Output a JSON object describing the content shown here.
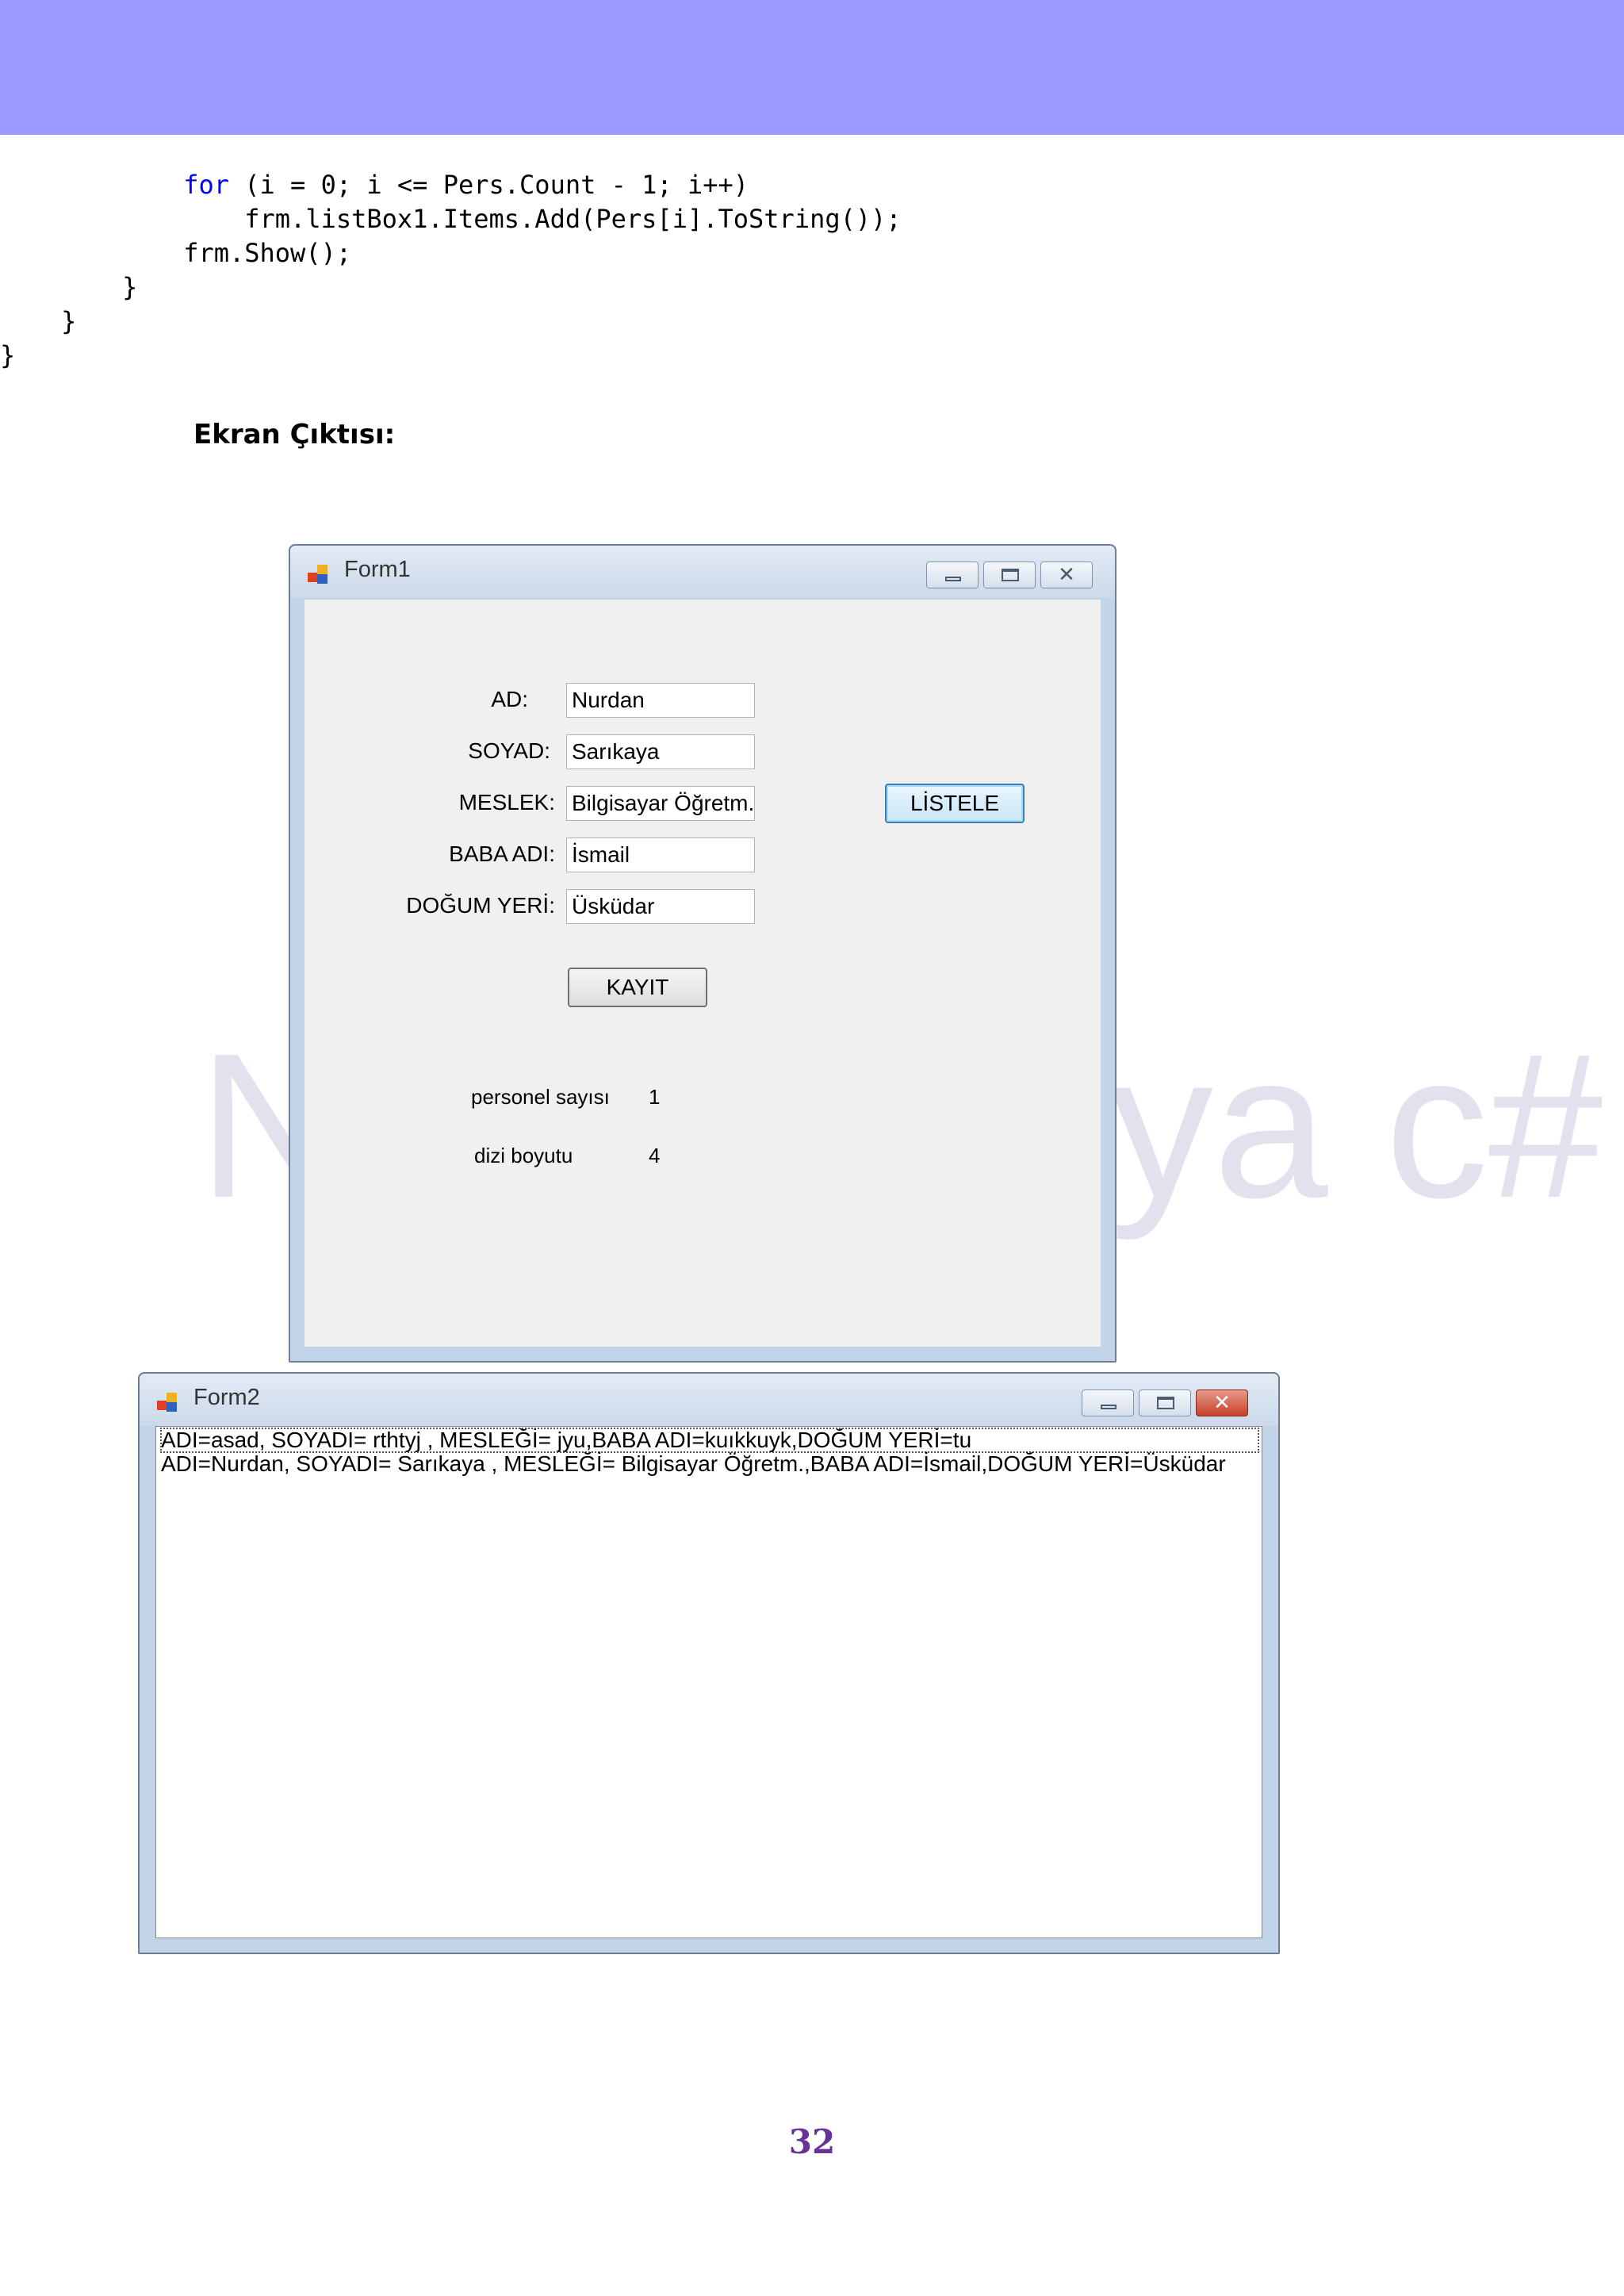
{
  "code_lines": [
    {
      "indent": "            ",
      "keyword": "for",
      "text": " (i = 0; i <= Pers.Count - 1; i++)"
    },
    {
      "indent": "                ",
      "keyword": "",
      "text": "frm.listBox1.Items.Add(Pers[i].ToString());"
    },
    {
      "indent": "            ",
      "keyword": "",
      "text": "frm.Show();"
    },
    {
      "indent": "        ",
      "keyword": "",
      "text": "}"
    },
    {
      "indent": "    ",
      "keyword": "",
      "text": "}"
    },
    {
      "indent": "",
      "keyword": "",
      "text": "}"
    }
  ],
  "section_title": "Ekran Çıktısı:",
  "watermark": {
    "left": "N",
    "right": "ya c#"
  },
  "form1": {
    "title": "Form1",
    "fields": [
      {
        "label": "AD:",
        "value": "Nurdan"
      },
      {
        "label": "SOYAD:",
        "value": "Sarıkaya"
      },
      {
        "label": "MESLEK:",
        "value": "Bilgisayar Öğretm."
      },
      {
        "label": "BABA ADI:",
        "value": "İsmail"
      },
      {
        "label": "DOĞUM YERİ:",
        "value": "Üsküdar"
      }
    ],
    "kayit_label": "KAYIT",
    "listele_label": "LİSTELE",
    "personel_label": "personel sayısı",
    "personel_value": "1",
    "dizi_label": "dizi boyutu",
    "dizi_value": "4"
  },
  "form2": {
    "title": "Form2",
    "list_items": [
      "ADI=asad, SOYADI= rthtyj , MESLEĞİ= jyu,BABA ADI=kuıkkuyk,DOĞUM YERİ=tu",
      "ADI=Nurdan, SOYADI= Sarıkaya , MESLEĞİ= Bilgisayar Öğretm.,BABA ADI=İsmail,DOĞUM YERİ=Üsküdar"
    ]
  },
  "icons": {
    "app": "windows-form-icon",
    "minimize": "minimize-icon",
    "maximize": "maximize-icon",
    "close": "close-icon"
  },
  "colors": {
    "header_band": "#9999ff",
    "keyword": "#0000ff",
    "page_number": "#663399"
  },
  "page_number": "32"
}
